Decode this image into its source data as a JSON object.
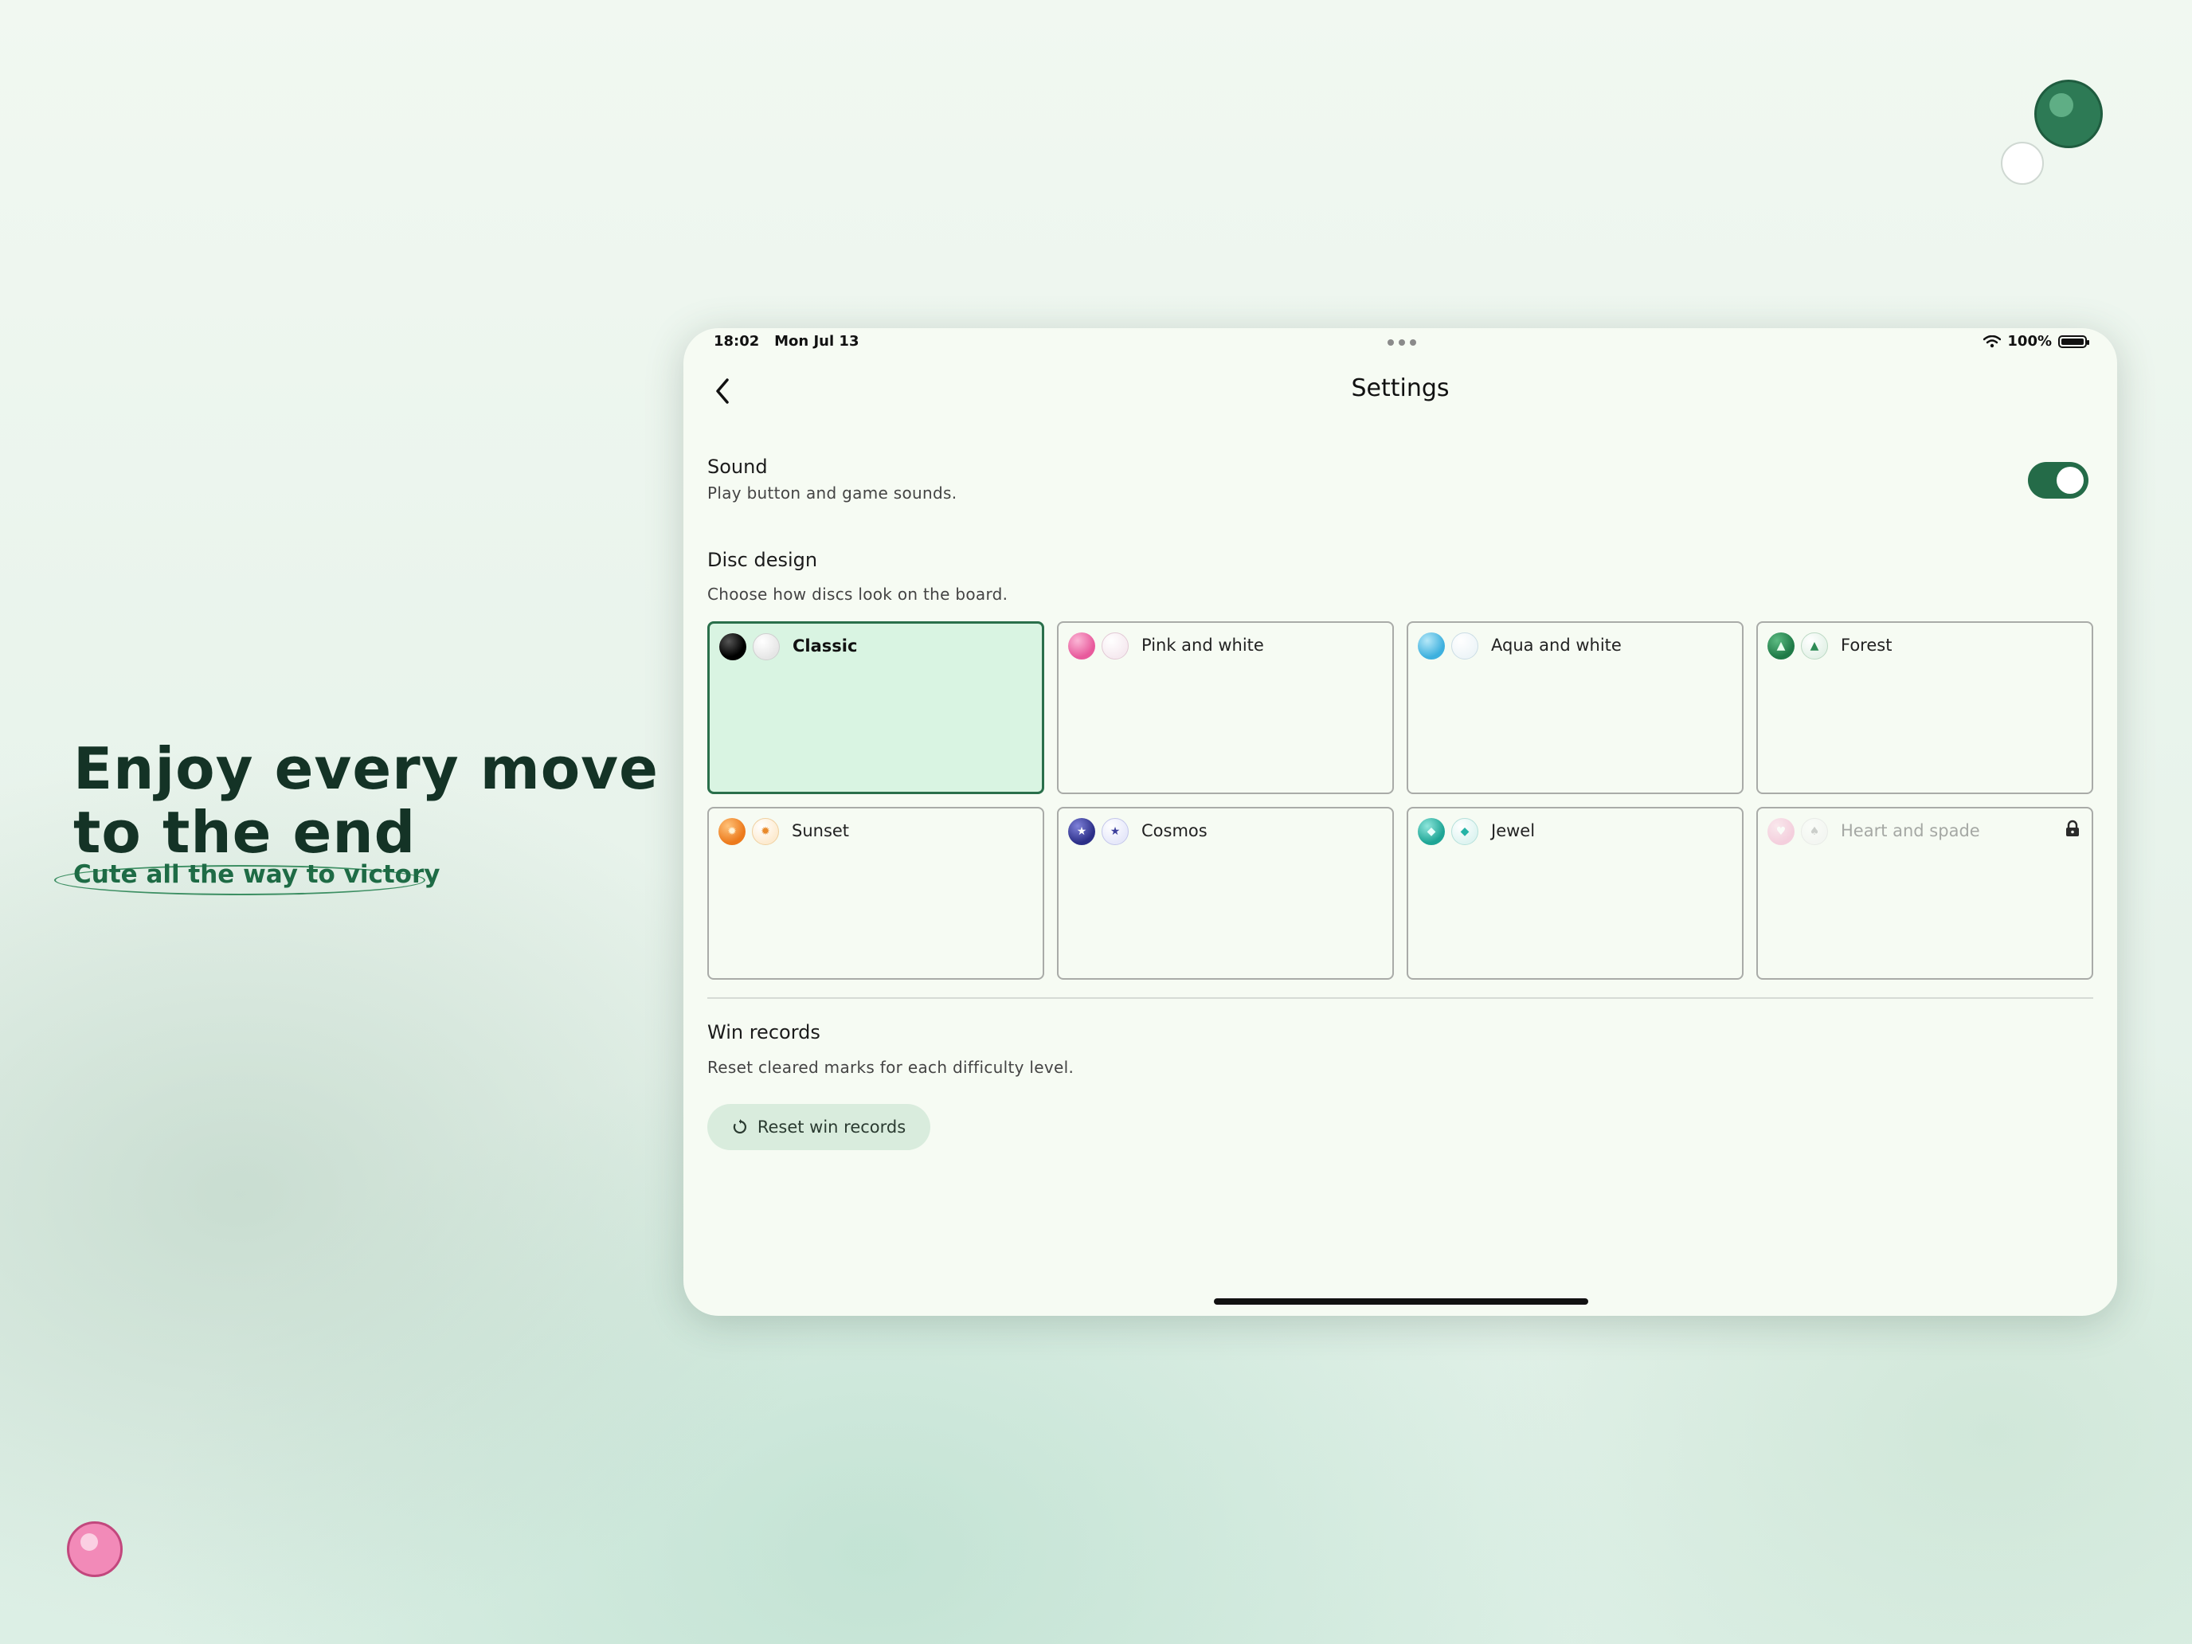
{
  "promo": {
    "headline_line1": "Enjoy every move",
    "headline_line2": "to the end",
    "tagline": "Cute all the way to victory"
  },
  "status_bar": {
    "time": "18:02",
    "date": "Mon Jul 13",
    "battery": "100%"
  },
  "nav": {
    "title": "Settings",
    "back_icon": "chevron-left-icon"
  },
  "sound": {
    "title": "Sound",
    "subtitle": "Play button and game sounds.",
    "enabled": true
  },
  "disc_design": {
    "title": "Disc design",
    "subtitle": "Choose how discs look on the board.",
    "selected": "Classic",
    "options": [
      {
        "label": "Classic",
        "selected": true,
        "locked": false,
        "colors": [
          "#111111",
          "#ffffff"
        ]
      },
      {
        "label": "Pink and white",
        "selected": false,
        "locked": false,
        "colors": [
          "#ef6fa8",
          "#ffffff"
        ]
      },
      {
        "label": "Aqua and white",
        "selected": false,
        "locked": false,
        "colors": [
          "#56bfe6",
          "#ffffff"
        ]
      },
      {
        "label": "Forest",
        "selected": false,
        "locked": false,
        "colors": [
          "#2e8a55",
          "#e9f6ec"
        ],
        "icon": "tree-icon"
      },
      {
        "label": "Sunset",
        "selected": false,
        "locked": false,
        "colors": [
          "#f28a2c",
          "#fff1dc"
        ],
        "icon": "sun-icon"
      },
      {
        "label": "Cosmos",
        "selected": false,
        "locked": false,
        "colors": [
          "#3c3f9c",
          "#eceefb"
        ],
        "icon": "star-icon"
      },
      {
        "label": "Jewel",
        "selected": false,
        "locked": false,
        "colors": [
          "#24b3a6",
          "#e4f7f4"
        ],
        "icon": "gem-icon"
      },
      {
        "label": "Heart and spade",
        "selected": false,
        "locked": true,
        "colors": [
          "#f29cc4",
          "#ffffff"
        ],
        "icon": "heart-icon"
      }
    ]
  },
  "win_records": {
    "title": "Win records",
    "subtitle": "Reset cleared marks for each difficulty level.",
    "button_label": "Reset win records",
    "button_icon": "reset-icon"
  },
  "colors": {
    "accent": "#246b48",
    "selected_card_bg": "#d9f4e2",
    "button_bg": "#d9ecdd"
  }
}
